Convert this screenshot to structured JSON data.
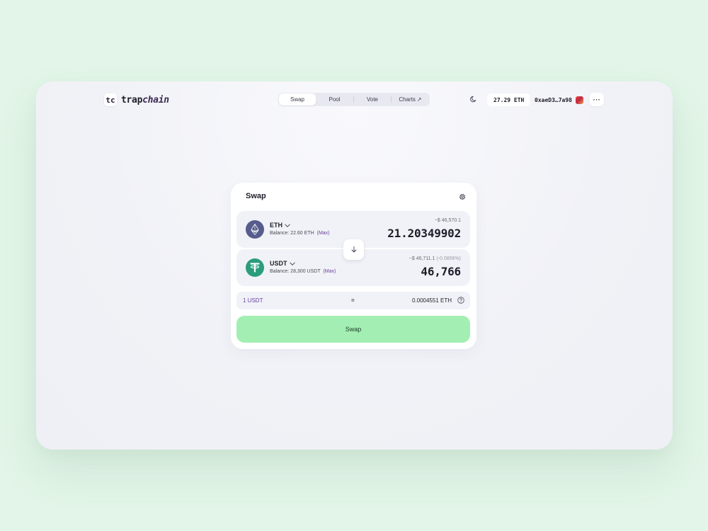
{
  "header": {
    "logo_mark": "tc",
    "logo_text_plain": "trap",
    "logo_text_accent": "chain",
    "nav": [
      {
        "label": "Swap"
      },
      {
        "label": "Pool"
      },
      {
        "label": "Vote"
      },
      {
        "label": "Charts",
        "ext": "↗"
      }
    ],
    "eth_balance": "27.29 ETH",
    "address": "0xaeD3…7a98",
    "more": "···"
  },
  "swap": {
    "title": "Swap",
    "from": {
      "symbol": "ETH",
      "balance_label": "Balance: 22.60 ETH",
      "max": "(Max)",
      "usd": "~$ 46,570.1",
      "amount": "21.20349902"
    },
    "to": {
      "symbol": "USDT",
      "balance_label": "Balance: 28,300 USDT",
      "max": "(Max)",
      "usd": "~$ 46,711.1",
      "usd_change": "(-0.0856%)",
      "amount": "46,766"
    },
    "rate": {
      "left": "1 USDT",
      "eq": "=",
      "right": "0.0004551 ETH"
    },
    "button": "Swap"
  },
  "colors": {
    "background": "#e2f5e8",
    "accent_purple": "#6a3fa0",
    "swap_button": "#a3efb3",
    "eth_icon": "#565c8c",
    "usdt_icon": "#2a9d7c"
  }
}
